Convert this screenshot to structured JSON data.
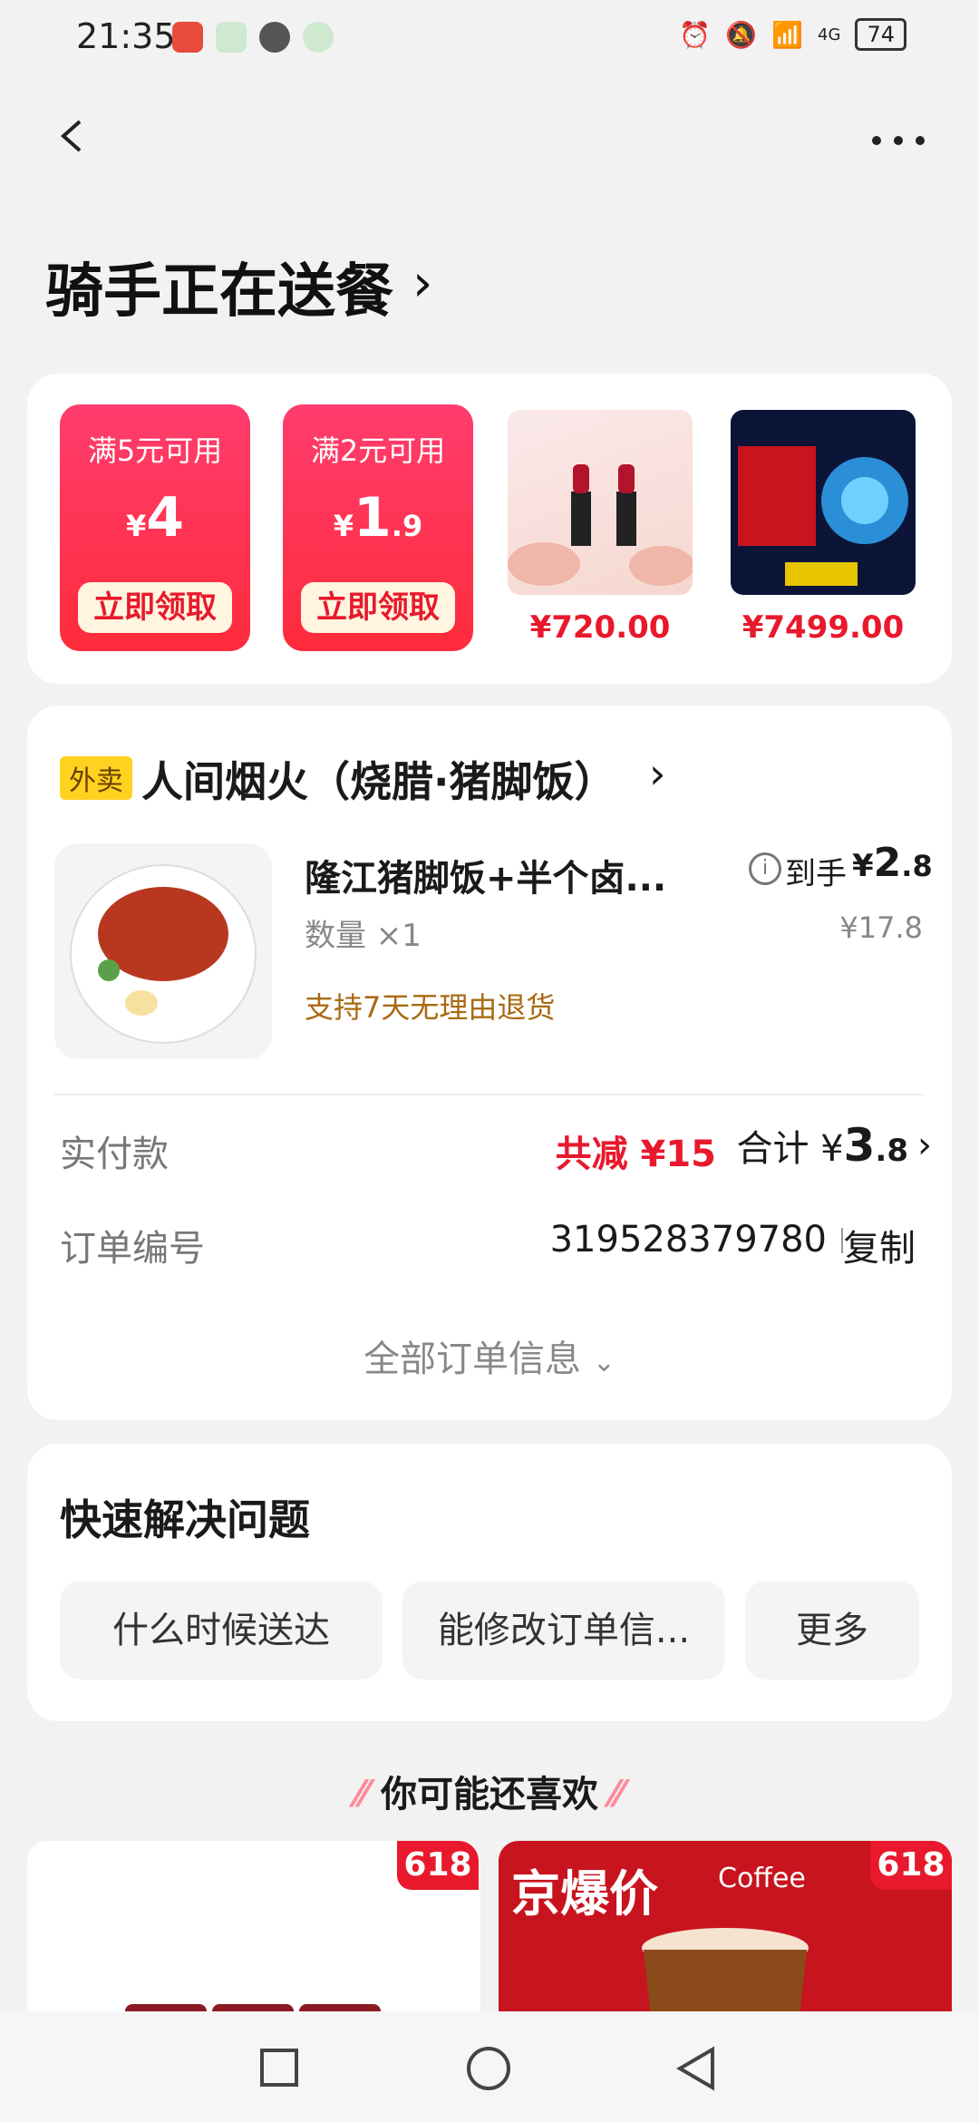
{
  "status_bar": {
    "time": "21:35",
    "signal": "4G",
    "battery": "74"
  },
  "header": {
    "title": "骑手正在送餐"
  },
  "promos": [
    {
      "condition": "满5元可用",
      "currency": "¥",
      "amount": "4",
      "amount_small": "",
      "claim": "立即领取"
    },
    {
      "condition": "满2元可用",
      "currency": "¥",
      "amount": "1",
      "amount_small": ".9",
      "claim": "立即领取"
    }
  ],
  "promo_products": [
    {
      "price": "¥720.00"
    },
    {
      "price": "¥7499.00"
    }
  ],
  "order": {
    "shop_tag": "外卖",
    "shop_name": "人间烟火（烧腊·猪脚饭）",
    "item_name": "隆江猪脚饭+半个卤...",
    "quantity": "数量 ×1",
    "refund_note": "支持7天无理由退货",
    "net_label": "到手",
    "net_currency": "¥",
    "net_int": "2",
    "net_dec": ".8",
    "original_price": "¥17.8",
    "paid_label": "实付款",
    "saving": "共减 ¥15",
    "total_label": "合计 ¥",
    "total_int": "3",
    "total_dec": ".8",
    "order_no_label": "订单编号",
    "order_no": "319528379780",
    "copy": "复制",
    "all_info": "全部订单信息"
  },
  "quick": {
    "title": "快速解决问题",
    "chips": [
      "什么时候送达",
      "能修改订单信...",
      "更多"
    ]
  },
  "recommend": {
    "title": "你可能还喜欢",
    "badge": "618",
    "right_banner": "京爆价",
    "right_banner_sub": "Coffee"
  }
}
